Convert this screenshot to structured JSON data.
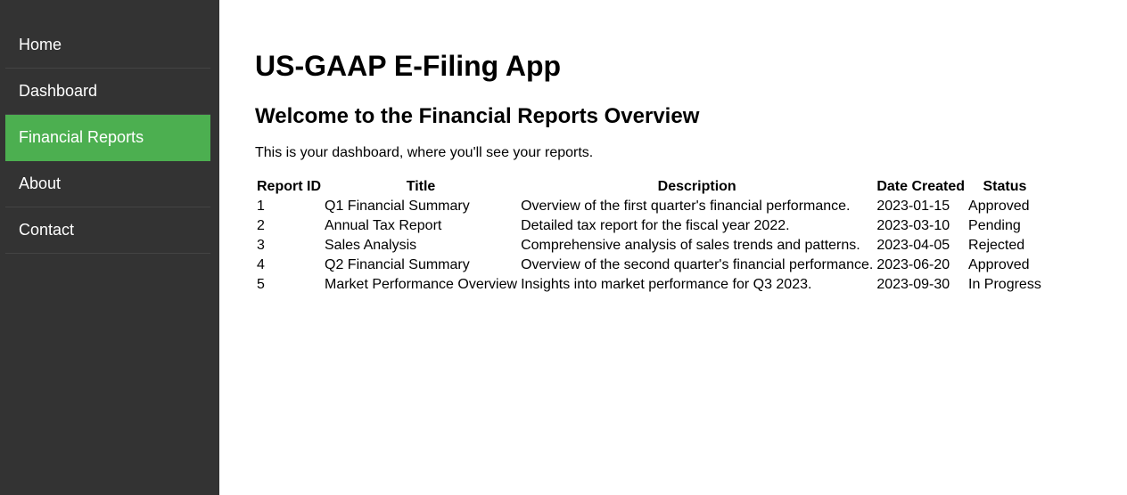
{
  "sidebar": {
    "items": [
      {
        "label": "Home",
        "active": false
      },
      {
        "label": "Dashboard",
        "active": false
      },
      {
        "label": "Financial Reports",
        "active": true
      },
      {
        "label": "About",
        "active": false
      },
      {
        "label": "Contact",
        "active": false
      }
    ],
    "active_color": "#4caf50",
    "background": "#333333"
  },
  "main": {
    "title": "US-GAAP E-Filing App",
    "subtitle": "Welcome to the Financial Reports Overview",
    "intro": "This is your dashboard, where you'll see your reports.",
    "table": {
      "headers": [
        "Report ID",
        "Title",
        "Description",
        "Date Created",
        "Status"
      ],
      "rows": [
        [
          "1",
          "Q1 Financial Summary",
          "Overview of the first quarter's financial performance.",
          "2023-01-15",
          "Approved"
        ],
        [
          "2",
          "Annual Tax Report",
          "Detailed tax report for the fiscal year 2022.",
          "2023-03-10",
          "Pending"
        ],
        [
          "3",
          "Sales Analysis",
          "Comprehensive analysis of sales trends and patterns.",
          "2023-04-05",
          "Rejected"
        ],
        [
          "4",
          "Q2 Financial Summary",
          "Overview of the second quarter's financial performance.",
          "2023-06-20",
          "Approved"
        ],
        [
          "5",
          "Market Performance Overview",
          "Insights into market performance for Q3 2023.",
          "2023-09-30",
          "In Progress"
        ]
      ]
    }
  }
}
